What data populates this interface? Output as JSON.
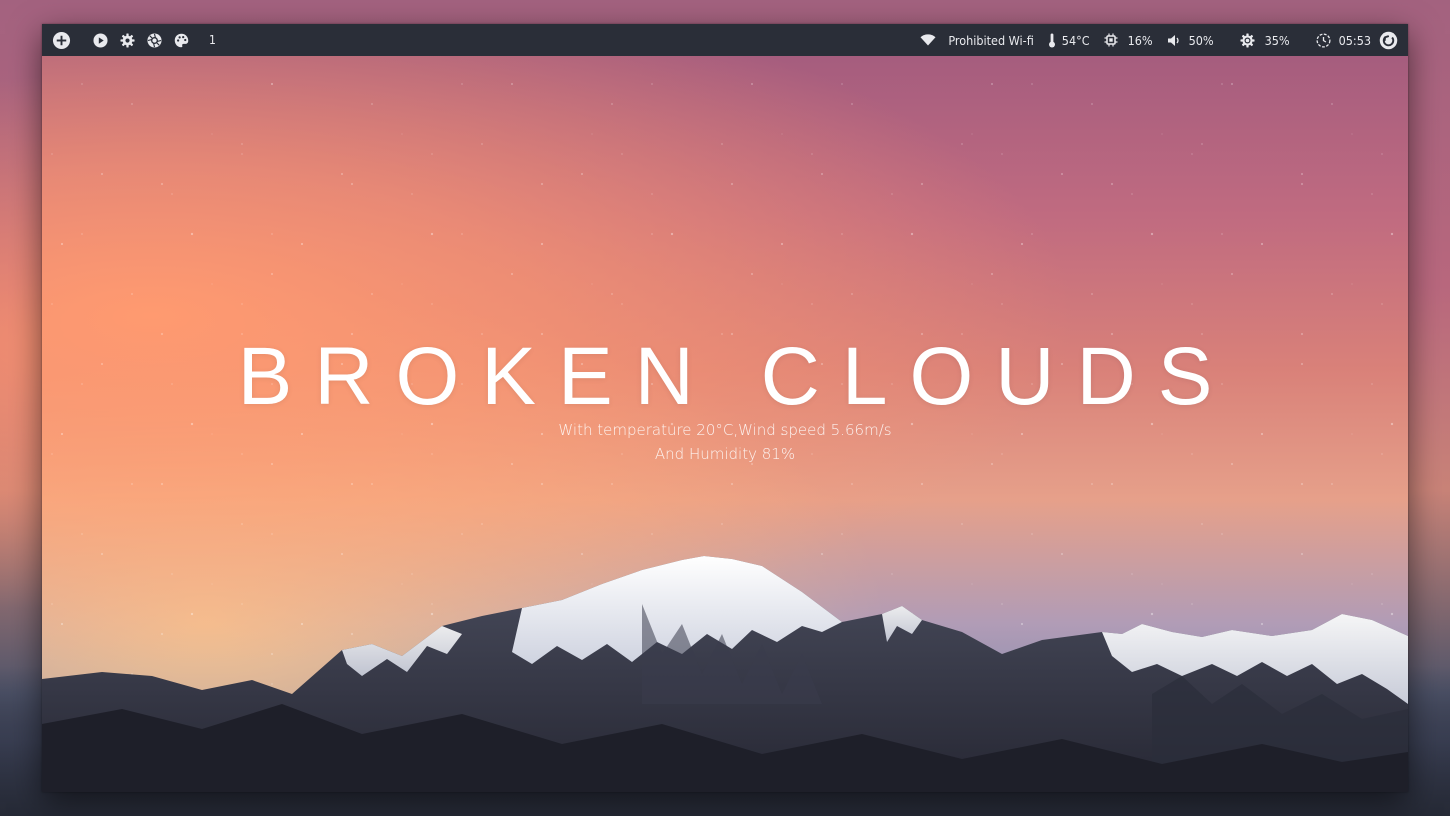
{
  "topbar": {
    "left_icons": [
      "add-icon",
      "play-icon",
      "settings-icon",
      "aperture-icon",
      "palette-icon"
    ],
    "workspace": "1",
    "wifi_name": "Prohibited Wi-fi",
    "temperature": "54°C",
    "cpu": "16%",
    "volume": "50%",
    "brightness": "35%",
    "time": "05:53"
  },
  "weather": {
    "condition": "BROKEN CLOUDS",
    "line1": "With temperature 20°C,Wind speed 5.66m/s",
    "line2": "And Humidity 81%"
  },
  "colors": {
    "bar_background": "#2a2e38",
    "bar_text": "#e9eaee",
    "sky_top": "#a05a7e",
    "sky_glow": "#ff9a70",
    "text": "#ffffff"
  }
}
